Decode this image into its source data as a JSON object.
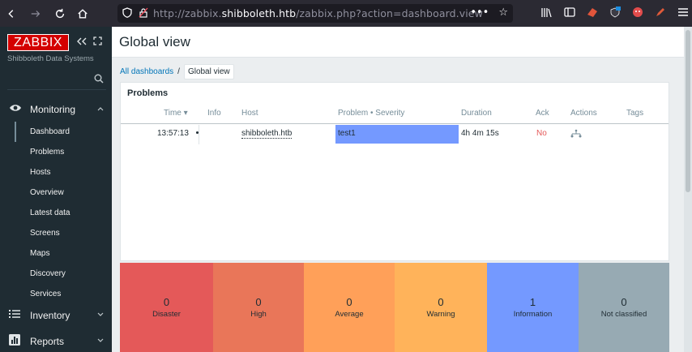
{
  "browser": {
    "url_prefix": "http://zabbix.",
    "url_domain": "shibboleth.htb",
    "url_suffix": "/zabbix.php?action=dashboard.view"
  },
  "sidebar": {
    "logo": "ZABBIX",
    "org_name": "Shibboleth Data Systems",
    "sections": [
      {
        "label": "Monitoring",
        "icon": "eye-icon",
        "expanded": true
      },
      {
        "label": "Inventory",
        "icon": "list-icon",
        "expanded": false
      },
      {
        "label": "Reports",
        "icon": "bar-chart-icon",
        "expanded": false
      }
    ],
    "monitoring_items": [
      "Dashboard",
      "Problems",
      "Hosts",
      "Overview",
      "Latest data",
      "Screens",
      "Maps",
      "Discovery",
      "Services"
    ],
    "active_item": "Dashboard"
  },
  "page": {
    "title": "Global view",
    "breadcrumb": {
      "root": "All dashboards",
      "separator": "/",
      "current": "Global view"
    }
  },
  "problems_widget": {
    "title": "Problems",
    "columns": [
      "Time ▾",
      "Info",
      "Host",
      "Problem • Severity",
      "Duration",
      "Ack",
      "Actions",
      "Tags"
    ],
    "rows": [
      {
        "time": "13:57:13",
        "info": "",
        "host": "shibboleth.htb",
        "problem": "test1",
        "duration": "4h 4m 15s",
        "ack": "No",
        "actions": "",
        "tags": ""
      }
    ]
  },
  "severity_widget": {
    "items": [
      {
        "label": "Disaster",
        "count": "0",
        "color": "#e45959"
      },
      {
        "label": "High",
        "count": "0",
        "color": "#e97659"
      },
      {
        "label": "Average",
        "count": "0",
        "color": "#ffa059"
      },
      {
        "label": "Warning",
        "count": "0",
        "color": "#ffc859"
      },
      {
        "label": "Information",
        "count": "1",
        "color": "#7499ff"
      },
      {
        "label": "Not classified",
        "count": "0",
        "color": "#97aab3"
      }
    ]
  },
  "colors": {
    "sidebar_bg": "#1f2c33",
    "logo_bg": "#d40000",
    "link": "#0275b8",
    "browser_bg": "#2b2a33"
  }
}
